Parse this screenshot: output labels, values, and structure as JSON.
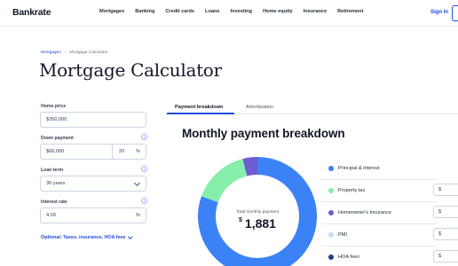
{
  "nav": {
    "logo": "Bankrate",
    "items": [
      "Mortgages",
      "Banking",
      "Credit cards",
      "Loans",
      "Investing",
      "Home equity",
      "Insurance",
      "Retirement"
    ],
    "signin": "Sign In"
  },
  "breadcrumb": {
    "parent": "Mortgages",
    "separator": "›",
    "current": "Mortgage Calculator"
  },
  "page_title": "Mortgage Calculator",
  "form": {
    "home_price": {
      "label": "Home price",
      "value": "$350,000"
    },
    "down_payment": {
      "label": "Down payment",
      "value": "$66,000",
      "percent": "20",
      "percent_sign": "%"
    },
    "loan_term": {
      "label": "Loan term",
      "value": "30 years"
    },
    "interest_rate": {
      "label": "Interest rate",
      "value": "4.09",
      "percent_sign": "%"
    },
    "info_glyph": "i",
    "optional_link": "Optional: Taxes, insurance, HOA fees"
  },
  "tabs": [
    {
      "label": "Payment breakdown",
      "active": true
    },
    {
      "label": "Amortization",
      "active": false
    }
  ],
  "breakdown": {
    "title": "Monthly payment breakdown",
    "total_label": "Total monthly payment",
    "total_currency": "$",
    "total_value": "1,881"
  },
  "legend": [
    {
      "label": "Principal & interest",
      "color": "#3b82f6",
      "input": ""
    },
    {
      "label": "Property tax",
      "color": "#86efac",
      "input": "$"
    },
    {
      "label": "Homeowner's insurance",
      "color": "#6d5bd0",
      "input": "$"
    },
    {
      "label": "PMI",
      "color": "#bfdbfe",
      "input": "$"
    },
    {
      "label": "HOA fees",
      "color": "#1e3a8a",
      "input": "$"
    }
  ],
  "chart_data": {
    "type": "pie",
    "categories": [
      "Principal & interest",
      "Property tax",
      "Homeowner's insurance"
    ],
    "values": [
      80.5,
      15.5,
      4
    ],
    "colors": [
      "#3b82f6",
      "#86efac",
      "#6d5bd0"
    ]
  }
}
